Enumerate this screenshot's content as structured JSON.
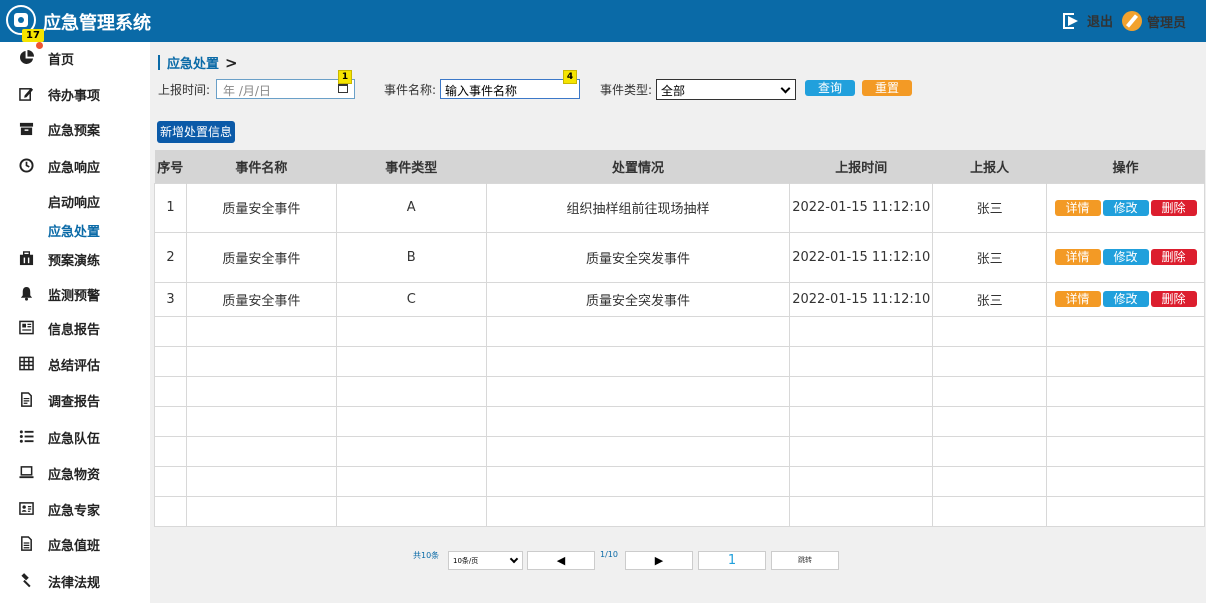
{
  "app": {
    "title": "应急管理系统"
  },
  "header": {
    "logout_label": "退出",
    "user_label": "管理员"
  },
  "sidebar": {
    "items": [
      {
        "label": "首页"
      },
      {
        "label": "待办事项",
        "badge": "17"
      },
      {
        "label": "应急预案"
      },
      {
        "label": "应急响应"
      },
      {
        "label": "启动响应"
      },
      {
        "label": "应急处置"
      },
      {
        "label": "预案演练"
      },
      {
        "label": "监测预警"
      },
      {
        "label": "信息报告"
      },
      {
        "label": "总结评估"
      },
      {
        "label": "调查报告"
      },
      {
        "label": "应急队伍"
      },
      {
        "label": "应急物资"
      },
      {
        "label": "应急专家"
      },
      {
        "label": "应急值班"
      },
      {
        "label": "法律法规"
      }
    ]
  },
  "breadcrumb": {
    "current": "应急处置",
    "separator": ">"
  },
  "filters": {
    "report_time_label": "上报时间:",
    "date_placeholder": "年 /月/日",
    "date_hint": "1",
    "event_name_label": "事件名称:",
    "event_name_value": "输入事件名称",
    "event_name_hint": "4",
    "event_type_label": "事件类型:",
    "event_type_value": "全部",
    "query_label": "查询",
    "reset_label": "重置"
  },
  "toolbar": {
    "add_label": "新增处置信息"
  },
  "table": {
    "headers": [
      "序号",
      "事件名称",
      "事件类型",
      "处置情况",
      "上报时间",
      "上报人",
      "操作"
    ],
    "rows": [
      {
        "no": "1",
        "name": "质量安全事件",
        "type": "A",
        "status": "组织抽样组前往现场抽样",
        "time": "2022-01-15 11:12:10",
        "reporter": "张三"
      },
      {
        "no": "2",
        "name": "质量安全事件",
        "type": "B",
        "status": "质量安全突发事件",
        "time": "2022-01-15 11:12:10",
        "reporter": "张三"
      },
      {
        "no": "3",
        "name": "质量安全事件",
        "type": "C",
        "status": "质量安全突发事件",
        "time": "2022-01-15 11:12:10",
        "reporter": "张三"
      }
    ],
    "actions": {
      "detail": "详情",
      "edit": "修改",
      "delete": "删除"
    }
  },
  "pagination": {
    "total": "共10条",
    "page_size": "10条/页",
    "prev": "◀",
    "page_count": "1/10",
    "next": "▶",
    "page_input": "1",
    "jump": "跳转"
  },
  "colors": {
    "header": "#0a6aa7",
    "query": "#21a0dc",
    "reset": "#f39a25",
    "delete": "#dc1e2e",
    "add": "#0b5aa8"
  }
}
